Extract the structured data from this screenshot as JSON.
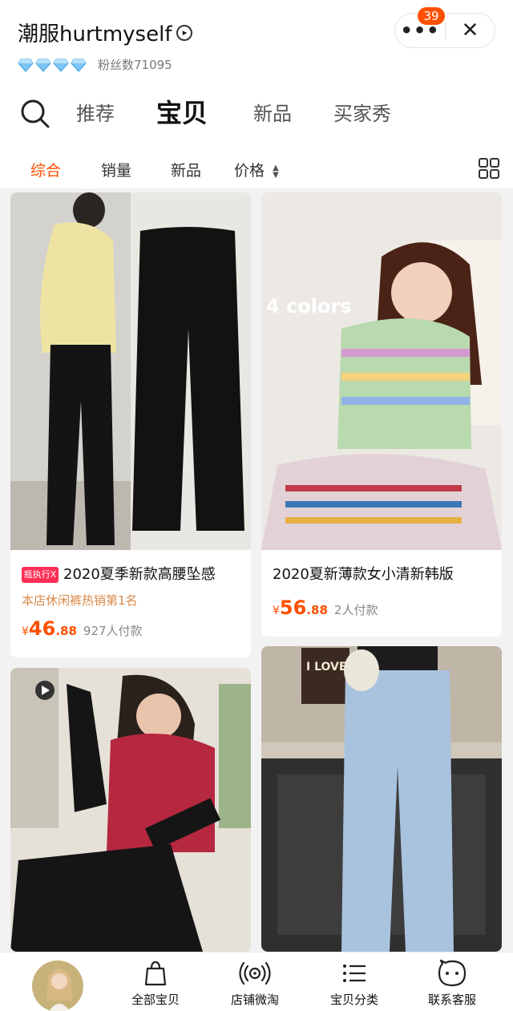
{
  "shop": {
    "name": "潮服hurtmyself",
    "fans": "粉丝数71095",
    "diamond_count": 4,
    "diamond_color": "#5ab4f0"
  },
  "capsule": {
    "badge": "39",
    "more_icon": "more-dots-icon",
    "close_icon": "close-icon"
  },
  "tabs": [
    "推荐",
    "宝贝",
    "新品",
    "买家秀"
  ],
  "active_tab": "宝贝",
  "filters": [
    "综合",
    "销量",
    "新品",
    "价格"
  ],
  "active_filter": "综合",
  "accent_color": "#ff5000",
  "products": [
    {
      "tag": "瓶执行X",
      "title": "2020夏季新款高腰坠感",
      "subtitle": "本店休闲裤热销第1名",
      "currency": "¥",
      "price_int": "46",
      "price_dec": ".88",
      "paid": "927人付款"
    },
    {
      "image_text": "4 colors",
      "title": "2020夏新薄款女小清新韩版",
      "currency": "¥",
      "price_int": "56",
      "price_dec": ".88",
      "paid": "2人付款"
    },
    {
      "title": ""
    },
    {
      "image_text": "I LOVE",
      "title": ""
    }
  ],
  "tabbar": {
    "items": [
      "全部宝贝",
      "店铺微淘",
      "宝贝分类",
      "联系客服"
    ]
  }
}
